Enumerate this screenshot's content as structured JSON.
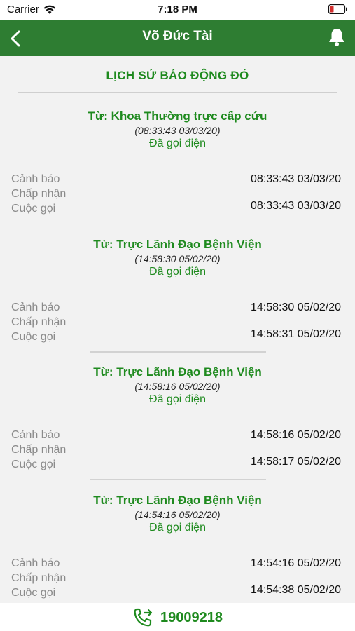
{
  "status_bar": {
    "carrier": "Carrier",
    "time": "7:18 PM"
  },
  "nav": {
    "title": "Võ Đức Tài",
    "back_icon": "chevron-left-icon",
    "bell_icon": "bell-icon"
  },
  "section_title": "LỊCH SỬ BÁO ĐỘNG ĐỎ",
  "labels": {
    "warning": "Cảnh báo",
    "accepted": "Chấp nhận",
    "call": "Cuộc gọi"
  },
  "records": [
    {
      "from": "Từ: Khoa Thường trực cấp cứu",
      "timestamp": "(08:33:43 03/03/20)",
      "status": "Đã gọi điện",
      "warning_time": "08:33:43 03/03/20",
      "call_time": "08:33:43 03/03/20"
    },
    {
      "from": "Từ: Trực Lãnh Đạo Bệnh Viện",
      "timestamp": "(14:58:30 05/02/20)",
      "status": "Đã gọi điện",
      "warning_time": "14:58:30 05/02/20",
      "call_time": "14:58:31 05/02/20"
    },
    {
      "from": "Từ: Trực Lãnh Đạo Bệnh Viện",
      "timestamp": "(14:58:16 05/02/20)",
      "status": "Đã gọi điện",
      "warning_time": "14:58:16 05/02/20",
      "call_time": "14:58:17 05/02/20"
    },
    {
      "from": "Từ: Trực Lãnh Đạo Bệnh Viện",
      "timestamp": "(14:54:16 05/02/20)",
      "status": "Đã gọi điện",
      "warning_time": "14:54:16 05/02/20",
      "call_time": "14:54:38 05/02/20"
    }
  ],
  "footer": {
    "phone": "19009218",
    "icon": "phone-forward-icon"
  },
  "colors": {
    "nav_bg": "#2e7d32",
    "accent_green": "#1e8a1e",
    "label_gray": "#8a8a8a",
    "background": "#f2f2f2"
  }
}
